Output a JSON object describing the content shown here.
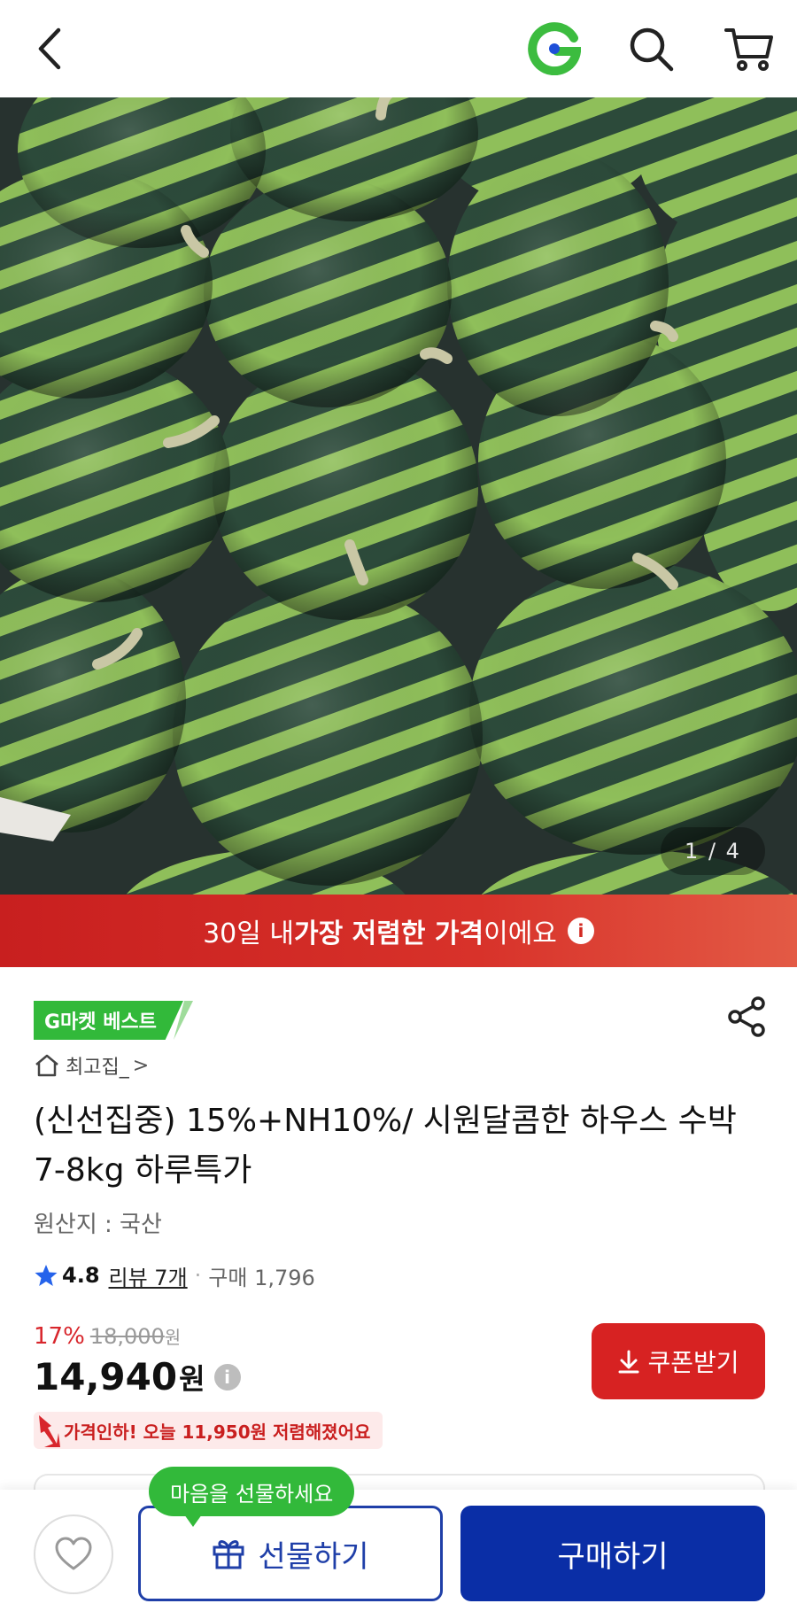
{
  "header": {
    "back_icon": "chevron-left-icon",
    "logo_icon": "g-logo-icon",
    "search_icon": "search-icon",
    "cart_icon": "cart-icon"
  },
  "gallery": {
    "page_indicator": "1 / 4"
  },
  "banner": {
    "prefix": "30일 내 ",
    "emphasis": "가장 저렴한 가격",
    "suffix": "이에요",
    "info_icon": "i"
  },
  "product": {
    "badge": "G마켓 베스트",
    "store_name": "최고집_",
    "store_chevron": ">",
    "title": "(신선집중) 15%+NH10%/ 시원달콤한 하우스 수박 7-8kg 하루특가",
    "origin": "원산지 : 국산",
    "rating": "4.8",
    "review_label": "리뷰 7개",
    "separator": "·",
    "purchase_count": "구매 1,796"
  },
  "pricing": {
    "discount_rate": "17%",
    "original_price": "18,000",
    "original_unit": "원",
    "price": "14,940",
    "price_unit": "원",
    "info_icon": "i",
    "coupon_label": "쿠폰받기",
    "price_cut_message": "가격인하! 오늘 11,950원 저렴해졌어요"
  },
  "bottom_bar": {
    "gift_tooltip": "마음을 선물하세요",
    "gift_label": "선물하기",
    "buy_label": "구매하기"
  },
  "colors": {
    "brand_green": "#32b93a",
    "sale_red": "#d72222",
    "primary_blue": "#0a2ea6"
  }
}
